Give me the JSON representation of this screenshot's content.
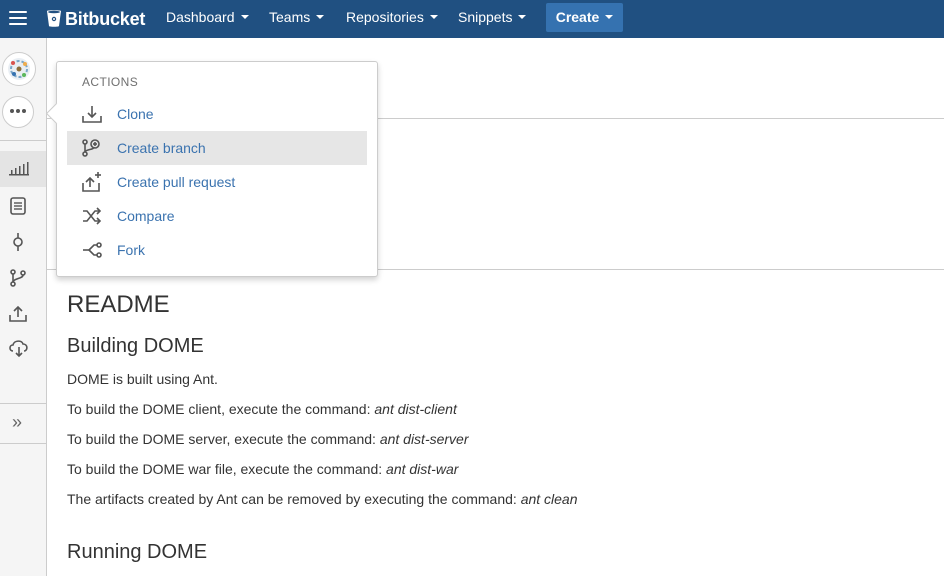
{
  "brand": {
    "name": "Bitbucket",
    "icon": "bitbucket-bucket-icon",
    "header_color": "#205081"
  },
  "nav": {
    "dashboard": "Dashboard",
    "teams": "Teams",
    "repositories": "Repositories",
    "snippets": "Snippets",
    "create": "Create"
  },
  "sidebar": {
    "items": [
      {
        "name": "overview",
        "icon": "bar-chart-icon",
        "active": true
      },
      {
        "name": "source",
        "icon": "document-icon"
      },
      {
        "name": "commits",
        "icon": "commit-icon"
      },
      {
        "name": "branches",
        "icon": "branch-icon"
      },
      {
        "name": "pull-requests",
        "icon": "upload-icon"
      },
      {
        "name": "downloads",
        "icon": "cloud-download-icon"
      }
    ],
    "expand_icon": "double-chevron-right-icon"
  },
  "actions_menu": {
    "heading": "ACTIONS",
    "items": [
      {
        "label": "Clone",
        "icon": "download-tray-icon"
      },
      {
        "label": "Create branch",
        "icon": "branch-add-icon",
        "hover": true
      },
      {
        "label": "Create pull request",
        "icon": "upload-plus-icon"
      },
      {
        "label": "Compare",
        "icon": "shuffle-icon"
      },
      {
        "label": "Fork",
        "icon": "fork-icon"
      }
    ]
  },
  "readme": {
    "title": "README",
    "building_heading": "Building DOME",
    "p1": "DOME is built using Ant.",
    "p2_text": "To build the DOME client, execute the command: ",
    "p2_cmd": "ant dist-client",
    "p3_text": "To build the DOME server, execute the command: ",
    "p3_cmd": "ant dist-server",
    "p4_text": "To build the DOME war file, execute the command: ",
    "p4_cmd": "ant dist-war",
    "p5_text": "The artifacts created by Ant can be removed by executing the command: ",
    "p5_cmd": "ant clean",
    "running_heading": "Running DOME"
  },
  "colors": {
    "link": "#3b73af",
    "create_button": "#3572b0"
  }
}
